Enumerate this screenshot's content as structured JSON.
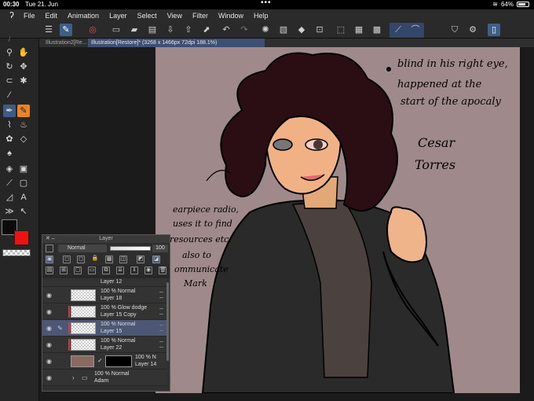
{
  "status_bar": {
    "time": "00:30",
    "date": "Tue 21. Jun",
    "battery": "64%"
  },
  "menu": [
    "File",
    "Edit",
    "Animation",
    "Layer",
    "Select",
    "View",
    "Filter",
    "Window",
    "Help"
  ],
  "tabs": [
    {
      "label": "Illustration2[Re..."
    },
    {
      "label": "Illustration[Restore]* (3268 x 1466px 72dpi 188.1%)"
    }
  ],
  "canvas_notes": {
    "note_top": "blind in his right eye,",
    "note_top2": "happened at the",
    "note_top3": "start of the apocaly",
    "name_first": "Cesar",
    "name_last": "Torres",
    "note_left1": "earpiece radio,",
    "note_left2": "uses it to find",
    "note_left3": "resources etc.",
    "note_left4": "also to",
    "note_left5": "ommunicate",
    "note_left6": "Mark"
  },
  "layer_panel": {
    "title": "Layer",
    "blend_mode": "Normal",
    "opacity": "100",
    "layers": [
      {
        "line1": "Layer 12",
        "line2": "",
        "selected": false
      },
      {
        "line1": "100 %  Normal",
        "line2": "Layer 18",
        "selected": false
      },
      {
        "line1": "100 %  Glow dodge",
        "line2": "Layer 15 Copy",
        "selected": false
      },
      {
        "line1": "100 %  Normal",
        "line2": "Layer 15",
        "selected": true
      },
      {
        "line1": "100 %  Normal",
        "line2": "Layer 22",
        "selected": false
      },
      {
        "line1": "100 %  N",
        "line2": "Layer 14",
        "selected": false
      },
      {
        "line1": "100 %  Normal",
        "line2": "Adam",
        "selected": false
      }
    ]
  },
  "colors": {
    "main": "#0b0b0b",
    "sub": "#ee1313",
    "canvas_bg": "#a0898b",
    "accent": "#3e5a85"
  }
}
